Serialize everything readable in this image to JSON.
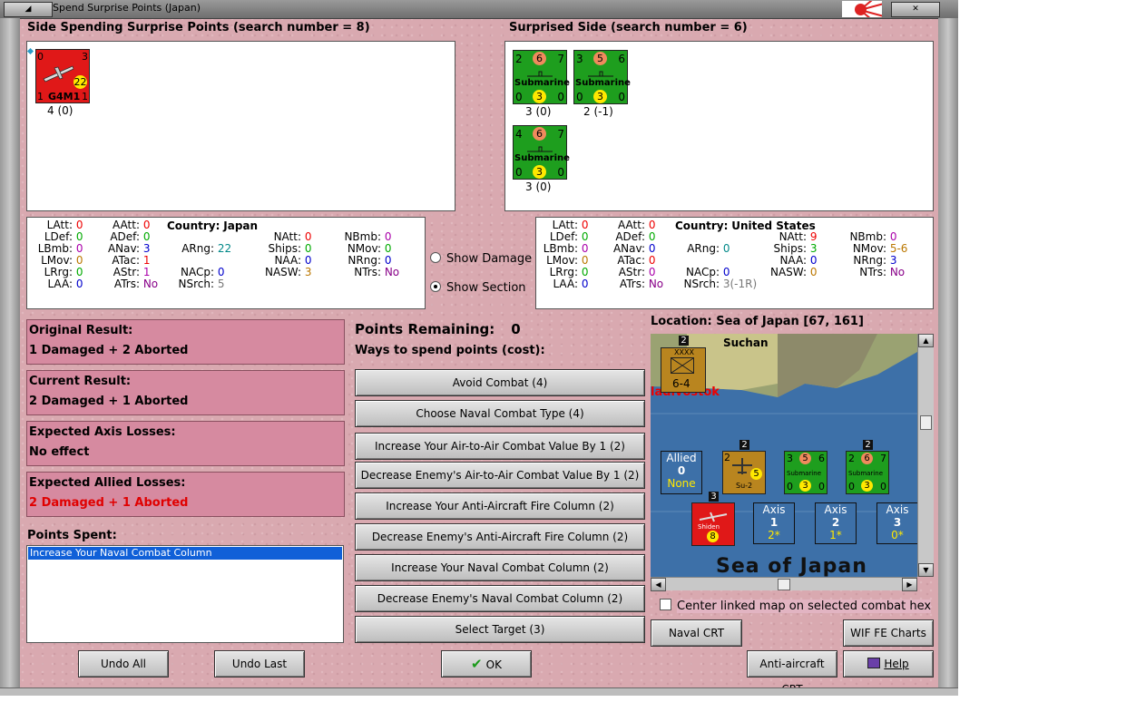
{
  "window": {
    "title": "Spend Surprise Points (Japan)"
  },
  "spending_side": {
    "heading": "Side Spending Surprise Points (search number = 8)",
    "units": [
      {
        "top_left": "0",
        "top_right": "3",
        "center": "22",
        "name": "G4M1",
        "bottom_left": "1",
        "bottom_right": "1",
        "caption": "4 (0)"
      }
    ]
  },
  "surprised_side": {
    "heading": "Surprised Side (search number = 6)",
    "units": [
      {
        "top_left": "2",
        "top_mid": "6",
        "top_right": "7",
        "name": "Submarine",
        "bottom_left": "0",
        "bottom_mid": "3",
        "bottom_right": "0",
        "caption": "3 (0)"
      },
      {
        "top_left": "3",
        "top_mid": "5",
        "top_right": "6",
        "name": "Submarine",
        "bottom_left": "0",
        "bottom_mid": "3",
        "bottom_right": "0",
        "caption": "2 (-1)"
      },
      {
        "top_left": "4",
        "top_mid": "6",
        "top_right": "7",
        "name": "Submarine",
        "bottom_left": "0",
        "bottom_mid": "3",
        "bottom_right": "0",
        "caption": "3 (0)"
      }
    ]
  },
  "stats_left": {
    "country_label": "Country:",
    "country": "Japan",
    "col1": [
      [
        "LAtt:",
        "0"
      ],
      [
        "LDef:",
        "0"
      ],
      [
        "LBmb:",
        "0"
      ],
      [
        "LMov:",
        "0"
      ],
      [
        "LRrg:",
        "0"
      ],
      [
        "LAA:",
        "0"
      ]
    ],
    "col2": [
      [
        "AAtt:",
        "0"
      ],
      [
        "ADef:",
        "0"
      ],
      [
        "ANav:",
        "3"
      ],
      [
        "ATac:",
        "1"
      ],
      [
        "AStr:",
        "1"
      ],
      [
        "ATrs:",
        "No"
      ]
    ],
    "col3": [
      [
        "ARng:",
        "22"
      ],
      [
        "NACp:",
        "0"
      ],
      [
        "NSrch:",
        "5"
      ]
    ],
    "col4": [
      [
        "NAtt:",
        "0"
      ],
      [
        "Ships:",
        "0"
      ],
      [
        "NAA:",
        "0"
      ],
      [
        "NASW:",
        "3"
      ]
    ],
    "col5": [
      [
        "NBmb:",
        "0"
      ],
      [
        "NMov:",
        "0"
      ],
      [
        "NRng:",
        "0"
      ],
      [
        "NTrs:",
        "No"
      ]
    ]
  },
  "stats_right": {
    "country_label": "Country:",
    "country": "United States",
    "col1": [
      [
        "LAtt:",
        "0"
      ],
      [
        "LDef:",
        "0"
      ],
      [
        "LBmb:",
        "0"
      ],
      [
        "LMov:",
        "0"
      ],
      [
        "LRrg:",
        "0"
      ],
      [
        "LAA:",
        "0"
      ]
    ],
    "col2": [
      [
        "AAtt:",
        "0"
      ],
      [
        "ADef:",
        "0"
      ],
      [
        "ANav:",
        "0"
      ],
      [
        "ATac:",
        "0"
      ],
      [
        "AStr:",
        "0"
      ],
      [
        "ATrs:",
        "No"
      ]
    ],
    "col3": [
      [
        "ARng:",
        "0"
      ],
      [
        "NACp:",
        "0"
      ],
      [
        "NSrch:",
        "3(-1R)"
      ]
    ],
    "col4": [
      [
        "NAtt:",
        "9"
      ],
      [
        "Ships:",
        "3"
      ],
      [
        "NAA:",
        "0"
      ],
      [
        "NASW:",
        "0"
      ]
    ],
    "col5": [
      [
        "NBmb:",
        "0"
      ],
      [
        "NMov:",
        "5-6"
      ],
      [
        "NRng:",
        "3"
      ],
      [
        "NTrs:",
        "No"
      ]
    ]
  },
  "options": {
    "show_damage": "Show Damage",
    "show_section": "Show Section"
  },
  "results": {
    "original_label": "Original Result:",
    "original": "1 Damaged + 2 Aborted",
    "current_label": "Current Result:",
    "current": "2 Damaged + 1 Aborted",
    "axis_label": "Expected Axis Losses:",
    "axis": "No effect",
    "allied_label": "Expected Allied Losses:",
    "allied": "2 Damaged + 1 Aborted"
  },
  "points": {
    "remaining_label": "Points Remaining:",
    "remaining": "0",
    "ways_label": "Ways to spend points (cost):",
    "spent_label": "Points Spent:",
    "spent_items": [
      "Increase Your Naval Combat Column"
    ]
  },
  "spend_buttons": [
    "Avoid Combat (4)",
    "Choose Naval Combat Type (4)",
    "Increase Your Air-to-Air Combat Value By 1 (2)",
    "Decrease Enemy's Air-to-Air Combat Value By 1 (2)",
    "Increase Your Anti-Aircraft Fire Column (2)",
    "Decrease Enemy's Anti-Aircraft Fire Column (2)",
    "Increase Your Naval Combat Column (2)",
    "Decrease Enemy's Naval Combat Column (2)",
    "Select Target (3)"
  ],
  "location": {
    "label": "Location: Sea of Japan [67, 161]",
    "map_place1": "Suchan",
    "map_place2": "ladivostok",
    "sea_name": "Sea of Japan",
    "army_counter": {
      "stack": "2",
      "type": "XXXX",
      "strength": "6-4"
    },
    "allied_box": {
      "title": "Allied",
      "value": "0",
      "sub": "None"
    },
    "axis_boxes": [
      {
        "title": "Axis",
        "value": "1",
        "sub": "2*"
      },
      {
        "title": "Axis",
        "value": "2",
        "sub": "1*"
      },
      {
        "title": "Axis",
        "value": "3",
        "sub": "0*"
      }
    ],
    "map_counters": {
      "su2": {
        "stack": "2",
        "tl": "2",
        "center": "5",
        "name": "Su-2"
      },
      "sub1": {
        "tl": "3",
        "tm": "5",
        "tr": "6",
        "name": "Submarine",
        "bl": "0",
        "bm": "3",
        "br": "0"
      },
      "sub2": {
        "stack": "2",
        "tl": "2",
        "tm": "6",
        "tr": "7",
        "name": "Submarine",
        "bl": "0",
        "bm": "3",
        "br": "0"
      },
      "jap_air": {
        "stack": "3",
        "name": "Shiden",
        "center": "8"
      }
    },
    "center_linked": "Center linked map on selected combat hex"
  },
  "buttons": {
    "naval_crt": "Naval CRT",
    "wif_charts": "WIF FE Charts",
    "aa_crt": "Anti-aircraft CRT",
    "help": "Help",
    "undo_all": "Undo All",
    "undo_last": "Undo Last",
    "ok": "OK"
  },
  "colors": {
    "background": "#d9a9b0",
    "result_box": "#d68aa0",
    "japan_counter": "#e01818",
    "us_counter": "#1e9e1e",
    "soviet_counter": "#b9851f",
    "sea": "#3d70a8",
    "allied_loss_text": "#e00000"
  }
}
